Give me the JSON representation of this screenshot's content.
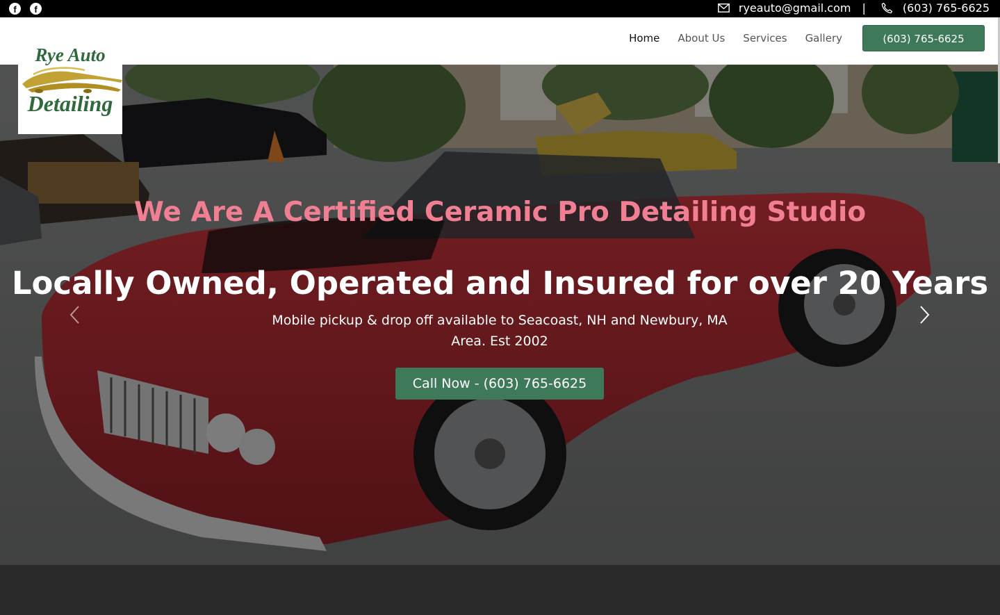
{
  "topbar": {
    "social": [
      "facebook-icon",
      "facebook-icon"
    ],
    "email": "ryeauto@gmail.com",
    "separator": "|",
    "phone": "(603) 765-6625"
  },
  "logo": {
    "line1": "Rye Auto",
    "line2": "Detailing"
  },
  "nav": {
    "items": [
      "Home",
      "About Us",
      "Services",
      "Gallery"
    ],
    "active": "Home",
    "phone_button": "(603) 765-6625"
  },
  "hero": {
    "tagline": "We Are A Certified Ceramic Pro Detailing Studio",
    "headline": "Locally Owned, Operated and Insured for over 20 Years",
    "subtext": "Mobile pickup & drop off available to Seacoast, NH and Newbury, MA Area. Est 2002",
    "cta": "Call Now - (603) 765-6625"
  },
  "colors": {
    "accent_green": "#3e7a5a",
    "tagline_pink": "#f07f93",
    "topbar_bg": "#000000"
  }
}
